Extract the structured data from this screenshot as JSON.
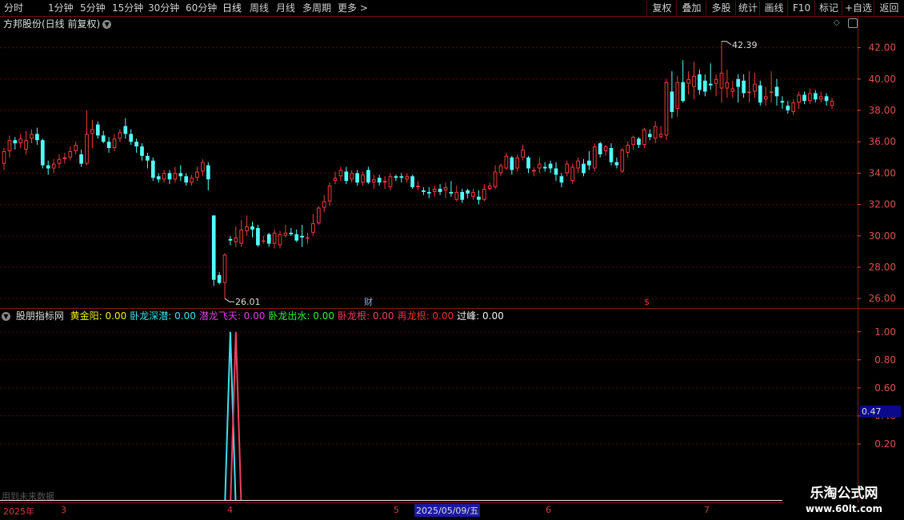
{
  "toolbar": {
    "timeframes": [
      "分时",
      "1分钟",
      "5分钟",
      "15分钟",
      "30分钟",
      "60分钟",
      "日线",
      "周线",
      "月线",
      "多周期",
      "更多 >"
    ],
    "active": "日线",
    "right_buttons": [
      "复权",
      "叠加",
      "多股",
      "统计",
      "画线",
      "F10",
      "+自选",
      "返回"
    ],
    "extra_button": "标记"
  },
  "main_chart": {
    "title": "方邦股份(日线 前复权)",
    "high_label": "42.39",
    "low_label": "26.01",
    "markers": [
      "财",
      "$"
    ]
  },
  "indicator": {
    "name": "股朋指标网",
    "items": [
      {
        "label": "黄金阳",
        "value": "0.00",
        "color": "#f0f000"
      },
      {
        "label": "卧龙深潜",
        "value": "0.00",
        "color": "#40e0f0"
      },
      {
        "label": "潜龙飞天",
        "value": "0.00",
        "color": "#e040e0"
      },
      {
        "label": "卧龙出水",
        "value": "0.00",
        "color": "#30f030"
      },
      {
        "label": "卧龙根",
        "value": "0.00",
        "color": "#f04060"
      },
      {
        "label": "再龙根",
        "value": "0.00",
        "color": "#f03030"
      },
      {
        "label": "过峰",
        "value": "0.00",
        "color": "#f0f0f0"
      }
    ],
    "current_value": "0.47",
    "future_note": "用到未来数据"
  },
  "date_axis": {
    "labels": [
      "2025年",
      "3",
      "4",
      "5",
      "6",
      "7"
    ],
    "cursor_date": "2025/05/09/五"
  },
  "watermark": {
    "line1": "乐淘公式网",
    "line2": "www.60lt.com"
  },
  "colors": {
    "up": "#f03c3c",
    "down": "#54fcfc",
    "axis": "#d85050",
    "grid": "#5a0d0d"
  },
  "chart_data": [
    {
      "type": "candlestick",
      "title": "方邦股份(日线 前复权)",
      "y_ticks": [
        26.0,
        28.0,
        30.0,
        32.0,
        34.0,
        36.0,
        38.0,
        40.0,
        42.0
      ],
      "ylim": [
        25.5,
        43.0
      ],
      "annotations": [
        {
          "label": "42.39",
          "value": 42.39
        },
        {
          "label": "26.01",
          "value": 26.01
        }
      ],
      "series": [
        [
          34.6,
          35.4,
          34.2,
          35.6
        ],
        [
          35.4,
          36.1,
          35.0,
          36.4
        ],
        [
          36.1,
          35.9,
          35.5,
          36.3
        ],
        [
          35.9,
          36.2,
          35.6,
          36.5
        ],
        [
          35.5,
          36.1,
          35.2,
          36.7
        ],
        [
          36.2,
          36.5,
          35.9,
          36.8
        ],
        [
          36.5,
          36.1,
          35.8,
          36.9
        ],
        [
          36.1,
          34.5,
          34.3,
          36.2
        ],
        [
          34.5,
          34.3,
          33.9,
          34.8
        ],
        [
          34.3,
          34.6,
          34.0,
          34.9
        ],
        [
          34.6,
          34.9,
          34.3,
          35.2
        ],
        [
          34.9,
          35.0,
          34.6,
          35.3
        ],
        [
          35.0,
          35.4,
          34.8,
          35.7
        ],
        [
          35.4,
          35.8,
          35.2,
          36.0
        ],
        [
          35.2,
          34.6,
          34.4,
          35.5
        ],
        [
          34.6,
          36.5,
          34.5,
          38.0
        ],
        [
          36.5,
          36.8,
          35.6,
          37.4
        ],
        [
          37.1,
          36.4,
          36.2,
          37.3
        ],
        [
          36.4,
          36.0,
          35.9,
          36.7
        ],
        [
          36.0,
          35.6,
          35.3,
          36.3
        ],
        [
          35.6,
          36.2,
          35.4,
          36.5
        ],
        [
          36.2,
          36.6,
          36.0,
          36.8
        ],
        [
          37.0,
          36.5,
          36.2,
          37.5
        ],
        [
          36.5,
          36.0,
          35.8,
          36.8
        ],
        [
          36.0,
          35.7,
          35.3,
          36.2
        ],
        [
          35.7,
          35.1,
          34.8,
          35.9
        ],
        [
          35.1,
          34.8,
          34.3,
          35.3
        ],
        [
          34.8,
          33.7,
          33.5,
          35.0
        ],
        [
          33.8,
          33.6,
          33.4,
          34.0
        ],
        [
          33.6,
          34.0,
          33.4,
          34.2
        ],
        [
          34.0,
          33.6,
          33.3,
          34.2
        ],
        [
          33.6,
          34.0,
          33.4,
          34.4
        ],
        [
          34.0,
          33.8,
          33.5,
          34.5
        ],
        [
          33.8,
          33.4,
          33.2,
          34.0
        ],
        [
          33.4,
          33.7,
          33.2,
          33.9
        ],
        [
          33.7,
          34.1,
          33.5,
          34.4
        ],
        [
          34.1,
          34.7,
          33.8,
          34.9
        ],
        [
          34.5,
          33.6,
          32.9,
          34.7
        ],
        [
          31.3,
          27.2,
          26.8,
          31.3
        ],
        [
          27.5,
          27.0,
          26.9,
          27.7
        ],
        [
          27.0,
          28.8,
          26.0,
          28.9
        ],
        [
          29.8,
          29.7,
          29.4,
          30.0
        ],
        [
          29.6,
          29.9,
          29.3,
          30.6
        ],
        [
          29.5,
          30.4,
          29.3,
          31.0
        ],
        [
          30.3,
          30.6,
          30.0,
          31.3
        ],
        [
          30.6,
          30.4,
          29.9,
          30.9
        ],
        [
          30.5,
          29.4,
          29.3,
          30.7
        ],
        [
          29.7,
          29.7,
          29.5,
          30.0
        ],
        [
          30.1,
          29.5,
          29.3,
          30.2
        ],
        [
          29.5,
          30.2,
          29.2,
          30.4
        ],
        [
          29.4,
          30.1,
          29.2,
          30.3
        ],
        [
          30.0,
          30.2,
          29.9,
          30.7
        ],
        [
          30.2,
          30.1,
          30.0,
          30.5
        ],
        [
          30.1,
          29.7,
          29.6,
          30.4
        ],
        [
          30.0,
          29.9,
          29.3,
          30.7
        ],
        [
          29.9,
          29.9,
          29.5,
          30.2
        ],
        [
          30.2,
          30.8,
          30.0,
          31.4
        ],
        [
          30.8,
          31.8,
          30.7,
          31.9
        ],
        [
          31.8,
          32.2,
          31.5,
          32.6
        ],
        [
          32.2,
          33.2,
          31.9,
          33.4
        ],
        [
          33.5,
          33.7,
          33.3,
          34.1
        ],
        [
          33.8,
          34.2,
          33.5,
          34.4
        ],
        [
          34.1,
          33.5,
          33.3,
          34.4
        ],
        [
          33.6,
          34.0,
          33.4,
          34.2
        ],
        [
          34.0,
          33.4,
          33.2,
          34.2
        ],
        [
          33.4,
          33.9,
          33.2,
          34.1
        ],
        [
          34.2,
          33.4,
          33.3,
          34.4
        ],
        [
          33.4,
          33.6,
          33.0,
          33.9
        ],
        [
          33.7,
          33.4,
          33.2,
          33.9
        ],
        [
          33.4,
          33.5,
          33.0,
          33.8
        ],
        [
          33.1,
          33.8,
          32.9,
          34.0
        ],
        [
          33.8,
          33.7,
          33.5,
          33.9
        ],
        [
          33.8,
          33.7,
          33.4,
          34.0
        ],
        [
          33.6,
          33.8,
          33.4,
          34.0
        ],
        [
          33.8,
          33.1,
          33.0,
          33.9
        ],
        [
          33.1,
          33.2,
          32.9,
          33.5
        ],
        [
          32.9,
          32.8,
          32.6,
          33.1
        ],
        [
          32.8,
          32.7,
          32.4,
          33.1
        ],
        [
          32.8,
          33.0,
          32.5,
          33.2
        ],
        [
          33.0,
          32.8,
          32.6,
          33.3
        ],
        [
          32.9,
          33.1,
          32.4,
          33.4
        ],
        [
          32.8,
          32.7,
          32.5,
          33.5
        ],
        [
          32.3,
          32.8,
          32.2,
          33.2
        ],
        [
          32.8,
          32.3,
          32.1,
          33.0
        ],
        [
          32.9,
          32.7,
          32.4,
          33.0
        ],
        [
          32.5,
          32.8,
          32.3,
          33.0
        ],
        [
          32.5,
          32.3,
          32.0,
          32.9
        ],
        [
          32.3,
          33.0,
          32.2,
          33.3
        ],
        [
          33.0,
          33.2,
          32.9,
          33.4
        ],
        [
          33.1,
          34.1,
          33.0,
          34.5
        ],
        [
          34.0,
          34.5,
          33.8,
          34.6
        ],
        [
          34.3,
          35.1,
          34.2,
          35.3
        ],
        [
          35.0,
          34.2,
          33.9,
          35.1
        ],
        [
          34.3,
          35.0,
          34.1,
          35.2
        ],
        [
          35.0,
          35.5,
          34.8,
          35.8
        ],
        [
          35.0,
          34.3,
          34.0,
          35.1
        ],
        [
          34.1,
          34.2,
          33.8,
          34.4
        ],
        [
          34.3,
          34.6,
          34.0,
          35.0
        ],
        [
          34.4,
          34.3,
          34.1,
          34.7
        ],
        [
          34.6,
          34.3,
          34.0,
          34.8
        ],
        [
          34.3,
          33.9,
          33.5,
          34.7
        ],
        [
          33.8,
          33.4,
          33.1,
          34.0
        ],
        [
          34.0,
          34.6,
          33.8,
          34.8
        ],
        [
          33.5,
          34.4,
          33.3,
          34.6
        ],
        [
          34.3,
          34.8,
          34.0,
          35.0
        ],
        [
          34.6,
          34.0,
          33.8,
          34.9
        ],
        [
          34.8,
          34.5,
          34.2,
          35.4
        ],
        [
          34.3,
          35.7,
          34.1,
          35.9
        ],
        [
          35.9,
          35.2,
          35.0,
          36.0
        ],
        [
          35.4,
          35.7,
          35.1,
          35.8
        ],
        [
          35.6,
          34.7,
          34.5,
          35.9
        ],
        [
          34.7,
          34.5,
          34.3,
          35.0
        ],
        [
          34.1,
          35.5,
          34.0,
          35.6
        ],
        [
          35.3,
          35.8,
          35.0,
          36.0
        ],
        [
          35.8,
          36.3,
          35.5,
          36.4
        ],
        [
          36.2,
          35.8,
          35.6,
          36.3
        ],
        [
          35.8,
          36.8,
          35.6,
          36.9
        ],
        [
          36.5,
          36.3,
          36.1,
          36.8
        ],
        [
          36.2,
          37.0,
          35.9,
          37.3
        ],
        [
          36.3,
          36.5,
          36.2,
          37.0
        ],
        [
          36.4,
          39.8,
          36.1,
          40.0
        ],
        [
          39.2,
          37.9,
          37.5,
          40.5
        ],
        [
          38.1,
          39.8,
          37.6,
          40.2
        ],
        [
          39.8,
          38.6,
          38.5,
          41.2
        ],
        [
          39.7,
          40.0,
          39.0,
          40.5
        ],
        [
          39.5,
          40.2,
          38.7,
          41.1
        ],
        [
          40.3,
          39.3,
          39.0,
          40.6
        ],
        [
          39.9,
          39.2,
          38.9,
          40.3
        ],
        [
          39.7,
          39.6,
          39.3,
          41.0
        ],
        [
          39.7,
          40.0,
          38.9,
          40.3
        ],
        [
          39.4,
          40.4,
          38.5,
          42.4
        ],
        [
          39.4,
          39.8,
          38.8,
          40.6
        ],
        [
          39.2,
          39.4,
          38.8,
          39.9
        ],
        [
          40.0,
          39.5,
          38.5,
          40.3
        ],
        [
          39.9,
          39.1,
          38.8,
          40.3
        ],
        [
          39.2,
          39.2,
          38.5,
          40.5
        ],
        [
          39.2,
          39.7,
          38.8,
          40.4
        ],
        [
          39.6,
          38.5,
          38.3,
          39.9
        ],
        [
          38.7,
          38.9,
          38.3,
          39.5
        ],
        [
          39.2,
          39.2,
          38.5,
          40.5
        ],
        [
          39.5,
          38.9,
          38.3,
          40.0
        ],
        [
          38.6,
          38.5,
          38.1,
          38.9
        ],
        [
          38.3,
          38.0,
          37.8,
          38.6
        ],
        [
          37.9,
          38.5,
          37.7,
          38.7
        ],
        [
          38.5,
          39.0,
          38.1,
          39.2
        ],
        [
          39.0,
          38.6,
          38.4,
          39.2
        ],
        [
          38.6,
          39.1,
          38.4,
          39.4
        ],
        [
          39.1,
          38.7,
          38.5,
          39.3
        ],
        [
          38.7,
          38.9,
          38.5,
          39.2
        ],
        [
          38.9,
          38.6,
          38.3,
          39.1
        ],
        [
          38.3,
          38.6,
          38.1,
          38.8
        ]
      ]
    },
    {
      "type": "line",
      "title": "股朋指标网",
      "y_ticks": [
        0.2,
        0.4,
        0.6,
        0.8,
        1.0
      ],
      "ylim": [
        -0.2,
        1.05
      ],
      "series": [
        {
          "name": "卧龙深潜",
          "color": "#40e0f0",
          "x": [
            0,
            1,
            2,
            3,
            4
          ],
          "values": [
            0,
            0,
            1,
            0,
            0
          ],
          "signal_index": 41
        },
        {
          "name": "卧龙根",
          "color": "#f04060",
          "x": [
            0,
            1,
            2,
            3,
            4
          ],
          "values": [
            0,
            0,
            1,
            0,
            0
          ],
          "signal_index": 42
        }
      ]
    }
  ]
}
